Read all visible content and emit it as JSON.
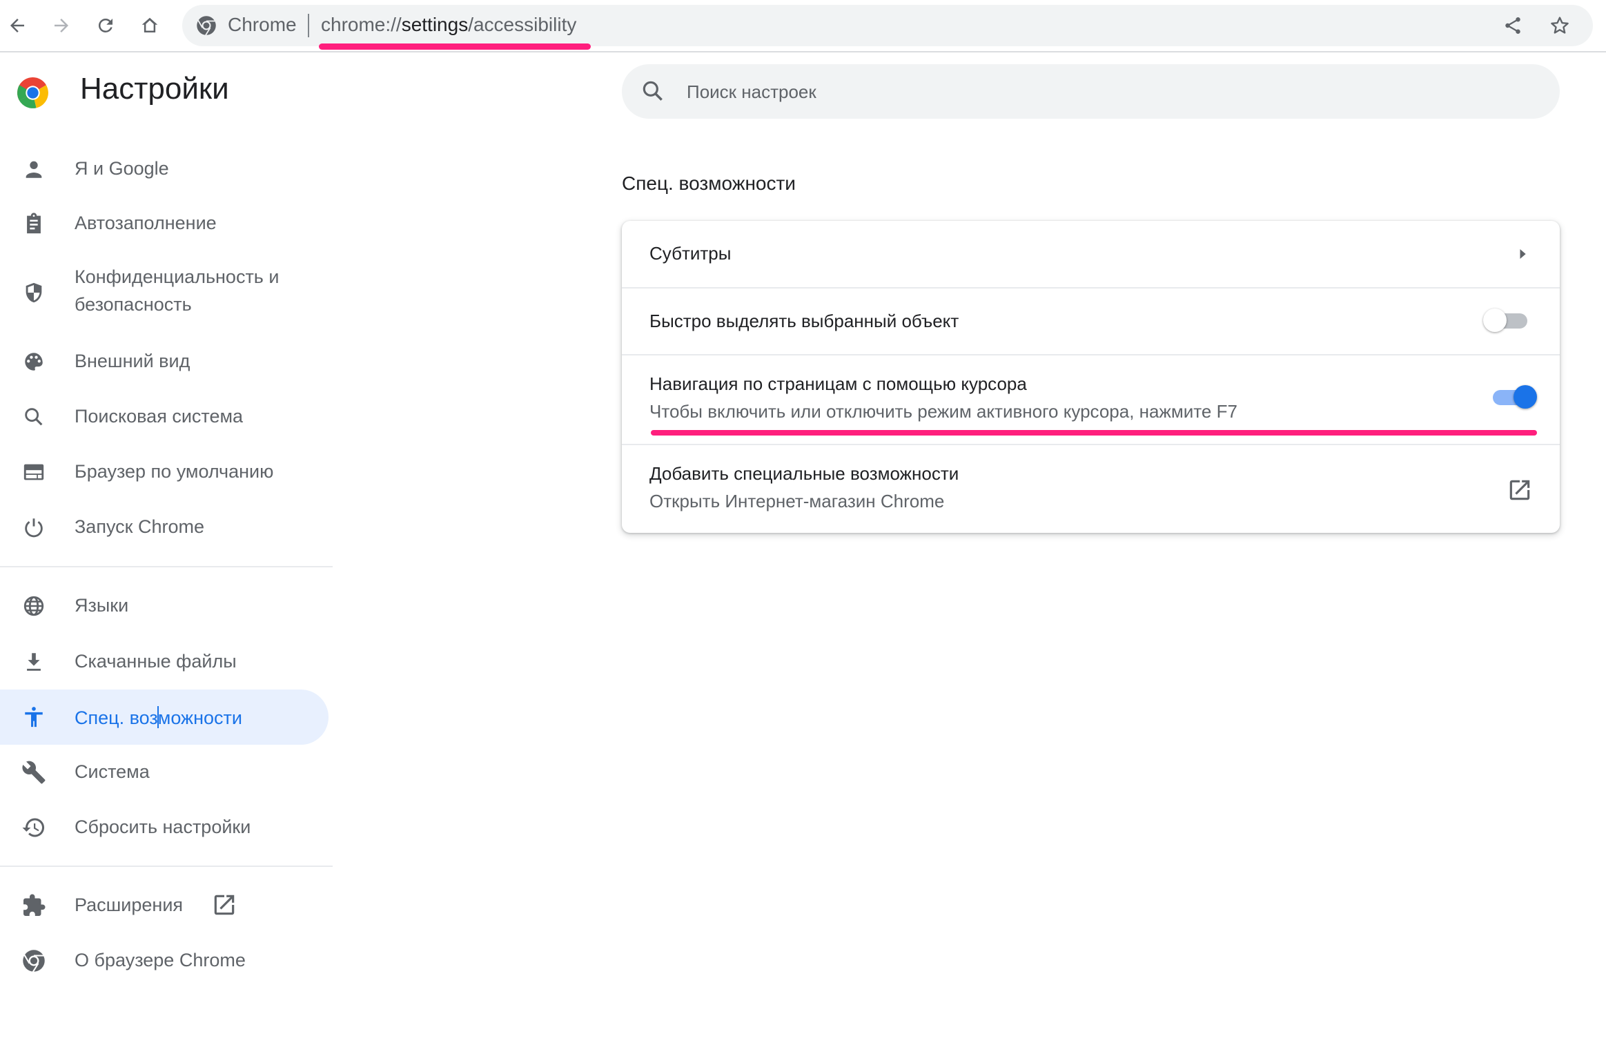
{
  "browser": {
    "nav": {
      "back_icon": "arrow-left-icon",
      "forward_icon": "arrow-right-icon",
      "reload_icon": "reload-icon",
      "home_icon": "home-icon"
    },
    "omnibox": {
      "site_label": "Chrome",
      "url_scheme": "chrome://",
      "url_host": "settings",
      "url_path": "/accessibility",
      "share_icon": "share-icon",
      "bookmark_icon": "star-icon"
    }
  },
  "header": {
    "title": "Настройки",
    "logo_icon": "chrome-logo-icon"
  },
  "search": {
    "placeholder": "Поиск настроек",
    "value": ""
  },
  "sidebar": {
    "items": [
      {
        "label": "Я и Google",
        "icon": "person-icon"
      },
      {
        "label": "Автозаполнение",
        "icon": "clipboard-icon"
      },
      {
        "label": "Конфиденциальность и безопасность",
        "icon": "shield-icon"
      },
      {
        "label": "Внешний вид",
        "icon": "palette-icon"
      },
      {
        "label": "Поисковая система",
        "icon": "search-icon"
      },
      {
        "label": "Браузер по умолчанию",
        "icon": "browser-window-icon"
      },
      {
        "label": "Запуск Chrome",
        "icon": "power-icon"
      },
      {
        "label": "Языки",
        "icon": "globe-icon"
      },
      {
        "label": "Скачанные файлы",
        "icon": "download-icon"
      },
      {
        "label_before_cursor": "Спец. воз",
        "label_after_cursor": "можности",
        "icon": "accessibility-icon",
        "active": true
      },
      {
        "label": "Система",
        "icon": "wrench-icon"
      },
      {
        "label": "Сбросить настройки",
        "icon": "restore-icon"
      },
      {
        "label": "Расширения",
        "icon": "puzzle-icon",
        "trailing_icon": "open-in-new-icon"
      },
      {
        "label": "О браузере Chrome",
        "icon": "chrome-icon"
      }
    ]
  },
  "main": {
    "section_title": "Спец. возможности",
    "rows": [
      {
        "title": "Субтитры",
        "control": "chevron-right-icon"
      },
      {
        "title": "Быстро выделять выбранный объект",
        "control": "toggle",
        "checked": false
      },
      {
        "title": "Навигация по страницам с помощью курсора",
        "subtitle": "Чтобы включить или отключить режим активного курсора, нажмите F7",
        "control": "toggle",
        "checked": true
      },
      {
        "title": "Добавить специальные возможности",
        "subtitle": "Открыть Интернет-магазин Chrome",
        "control": "open-in-new-icon"
      }
    ]
  },
  "colors": {
    "accent": "#1a73e8",
    "active_bg": "#e8f0fe",
    "annotation_underline": "#ff1f7d",
    "text_secondary": "#5f6368"
  }
}
